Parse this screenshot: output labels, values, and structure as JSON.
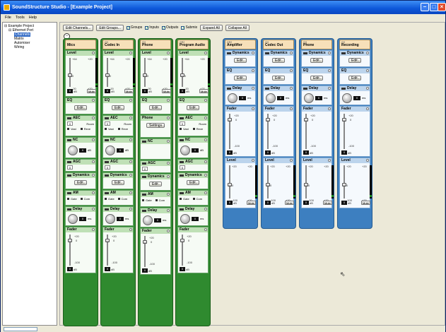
{
  "window": {
    "title": "SoundStructure Studio - [Example Project]"
  },
  "menu": [
    "File",
    "Tools",
    "Help"
  ],
  "tree": {
    "root": "Example Project",
    "port": "Ethernet Port",
    "items": [
      "Channels",
      "Matrix",
      "Automixer",
      "Wiring"
    ],
    "selected": "Channels"
  },
  "toolbar": {
    "edit_channels": "Edit Channels...",
    "edit_groups": "Edit Groups...",
    "checks": [
      "Groups",
      "Inputs",
      "Outputs",
      "Submix"
    ],
    "expand": "Expand All",
    "collapse": "Collapse All"
  },
  "circle_toggle": "−",
  "common": {
    "edit": "Edit...",
    "db": "dB",
    "mute": "Mute",
    "ms": "ms",
    "settings": "Settings...",
    "plus64": "+64",
    "plus20": "+20",
    "zero": "0",
    "minus20": "-20",
    "minus100": "-100",
    "room": "Room",
    "vast": "Vast",
    "reverb": "Reve",
    "gate": "Gate",
    "comp": "Com",
    "zero_box": "0"
  },
  "sections": {
    "level": "Level",
    "eq": "EQ",
    "aec": "AEC",
    "nc": "NC",
    "agc": "AGC",
    "dynamics": "Dynamics",
    "am": "AM",
    "delay": "Delay",
    "fader": "Fader",
    "phone": "Phone"
  },
  "inputs": [
    {
      "num": "",
      "name": "Mics"
    },
    {
      "num": "CH",
      "name": "Codec In"
    },
    {
      "num": "CH",
      "name": "Phone"
    },
    {
      "num": "GR2",
      "name": "Program Audio"
    }
  ],
  "outputs": [
    {
      "num": "GR2",
      "name": "Amplifier"
    },
    {
      "num": "CH",
      "name": "Codec Out"
    },
    {
      "num": "CH",
      "name": "Phone"
    },
    {
      "num": "CH",
      "name": "Recording"
    }
  ],
  "colors": {
    "input_strip": "#2f8a2f",
    "output_strip": "#3d7fc0",
    "header": "#f7e0b9",
    "titlebar": "#0c56d8"
  }
}
